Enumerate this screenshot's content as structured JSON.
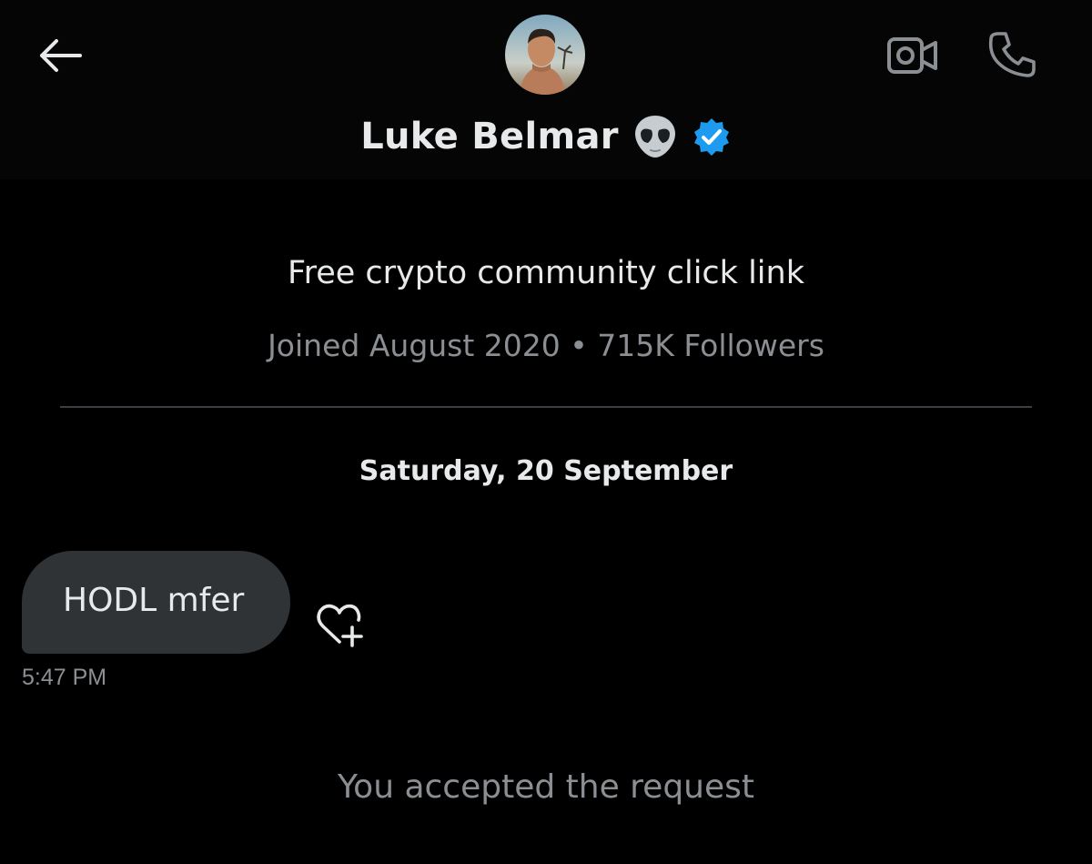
{
  "header": {
    "name": "Luke Belmar",
    "name_emoji_icon": "alien-emoji-icon",
    "verified_icon": "verified-badge-icon",
    "back_icon": "arrow-left-icon",
    "video_icon": "video-camera-icon",
    "call_icon": "phone-icon"
  },
  "profile": {
    "bio": "Free crypto community click link",
    "meta": "Joined August 2020 • 715K Followers"
  },
  "conversation": {
    "date_separator": "Saturday, 20 September",
    "messages": [
      {
        "text": "HODL mfer",
        "time": "5:47 PM",
        "react_icon": "heart-plus-icon"
      }
    ],
    "system_notice": "You accepted the request"
  },
  "colors": {
    "background": "#000000",
    "header_background": "#050505",
    "bubble": "#2f3336",
    "primary_text": "#e7e9ea",
    "secondary_text": "#8b8f93",
    "verified_blue": "#1d9bf0",
    "icon_gray": "#8b8f93"
  }
}
